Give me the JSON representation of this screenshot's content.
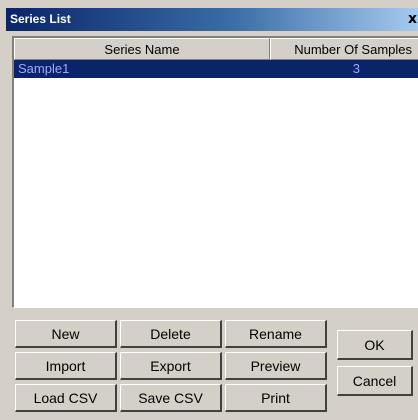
{
  "window": {
    "title": "Series List",
    "close_glyph": "x"
  },
  "list": {
    "columns": [
      "Series Name",
      "Number Of Samples"
    ],
    "rows": [
      {
        "name": "Sample1",
        "count": "3"
      }
    ]
  },
  "buttons": {
    "new": "New",
    "delete": "Delete",
    "rename": "Rename",
    "import": "Import",
    "export": "Export",
    "preview": "Preview",
    "load_csv": "Load CSV",
    "save_csv": "Save CSV",
    "print": "Print",
    "ok": "OK",
    "cancel": "Cancel"
  },
  "colors": {
    "dialog_face": "#d4d0c8",
    "title_active": "#0a246a",
    "selection_bg": "#0a246a",
    "selection_text": "#a6a6ff"
  }
}
